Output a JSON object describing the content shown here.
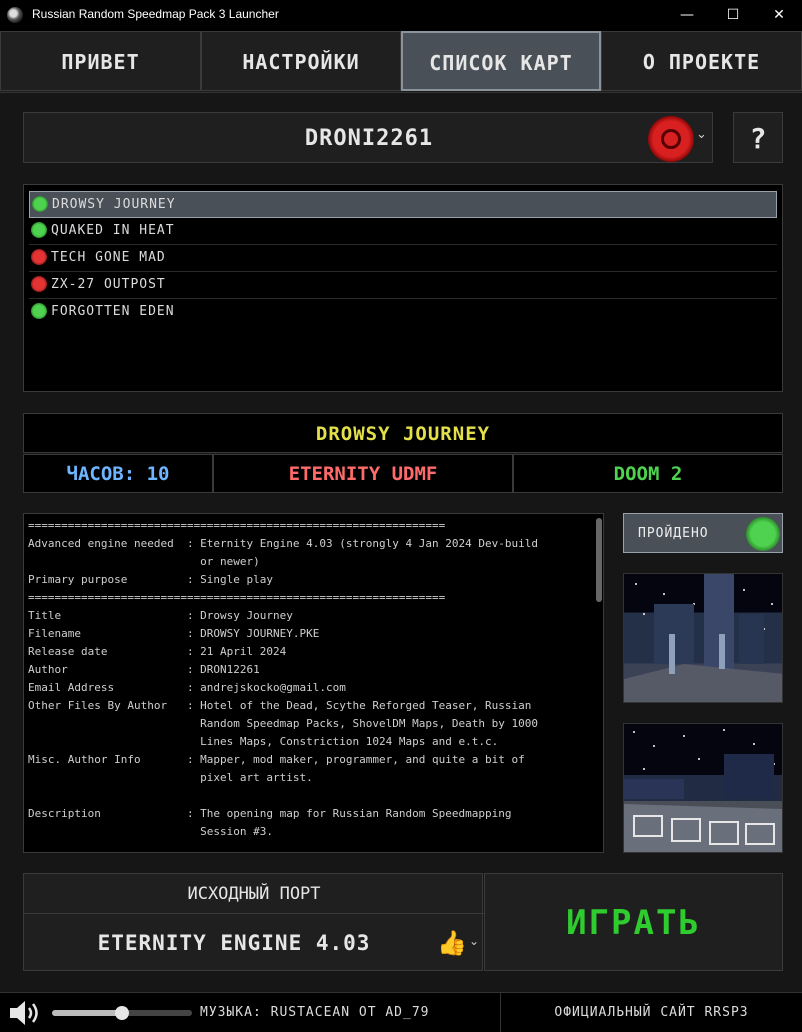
{
  "window": {
    "title": "Russian Random Speedmap Pack 3 Launcher",
    "minimize": "—",
    "maximize": "☐",
    "close": "✕"
  },
  "tabs": [
    {
      "label": "ПРИВЕТ",
      "active": false
    },
    {
      "label": "НАСТРОЙКИ",
      "active": false
    },
    {
      "label": "СПИСОК КАРТ",
      "active": true
    },
    {
      "label": "О ПРОЕКТЕ",
      "active": false
    }
  ],
  "profile": {
    "name": "DRONI2261",
    "status": "failed",
    "help_label": "?"
  },
  "maps": [
    {
      "name": "DROWSY JOURNEY",
      "completed": true,
      "selected": true
    },
    {
      "name": "QUAKED IN HEAT",
      "completed": true,
      "selected": false
    },
    {
      "name": "TECH GONE MAD",
      "completed": false,
      "selected": false
    },
    {
      "name": "ZX-27 OUTPOST",
      "completed": false,
      "selected": false
    },
    {
      "name": "FORGOTTEN EDEN",
      "completed": true,
      "selected": false
    }
  ],
  "map_info": {
    "title": "DROWSY JOURNEY",
    "hours": "ЧАСОВ: 10",
    "format": "ETERNITY UDMF",
    "game": "DOOM 2",
    "colors": {
      "title": "#e4e04a",
      "hours": "#6fb4ff",
      "format": "#ff6b6b",
      "game": "#4fd24f"
    }
  },
  "textfile": "===============================================================\nAdvanced engine needed  : Eternity Engine 4.03 (strongly 4 Jan 2024 Dev-build\n                          or newer)\nPrimary purpose         : Single play\n===============================================================\nTitle                   : Drowsy Journey\nFilename                : DROWSY JOURNEY.PKE\nRelease date            : 21 April 2024\nAuthor                  : DRON12261\nEmail Address           : andrejskocko@gmail.com\nOther Files By Author   : Hotel of the Dead, Scythe Reforged Teaser, Russian\n                          Random Speedmap Packs, ShovelDM Maps, Death by 1000\n                          Lines Maps, Constriction 1024 Maps and e.t.c.\nMisc. Author Info       : Mapper, mod maker, programmer, and quite a bit of\n                          pixel art artist.\n\nDescription             : The opening map for Russian Random Speedmapping\n                          Session #3.",
  "passed": {
    "label": "ПРОЙДЕНО"
  },
  "port": {
    "label": "ИСХОДНЫЙ ПОРТ",
    "value": "ETERNITY ENGINE 4.03"
  },
  "play": {
    "label": "ИГРАТЬ",
    "color": "#2fcc2f"
  },
  "footer": {
    "volume": 0.5,
    "music": "МУЗЫКА: RUSTACEAN ОТ AD_79",
    "site": "ОФИЦИАЛЬНЫЙ САЙТ RRSP3"
  }
}
